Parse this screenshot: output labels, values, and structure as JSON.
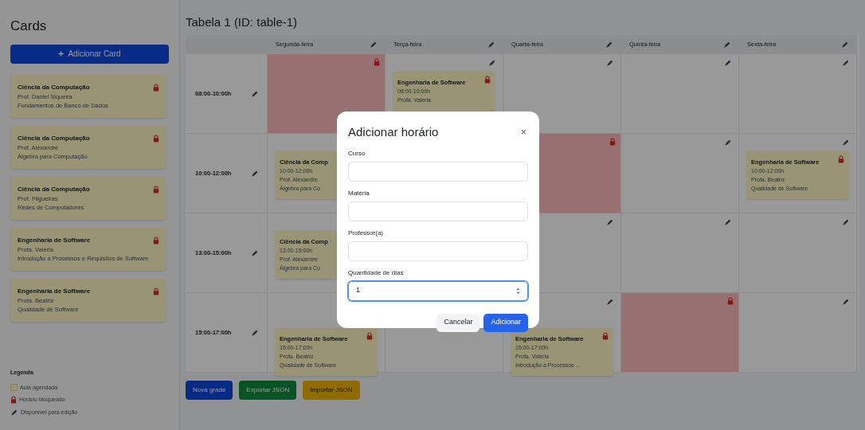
{
  "sidebar": {
    "title": "Cards",
    "add_button": "Adicionar Card",
    "cards": [
      {
        "course": "Ciência da Computação",
        "professor": "Prof. Daniel Siqueira",
        "subject": "Fundamentos de Banco de Dados"
      },
      {
        "course": "Ciência da Computação",
        "professor": "Prof. Alexandre",
        "subject": "Álgebra para Computação"
      },
      {
        "course": "Ciência da Computação",
        "professor": "Prof. Filgueiras",
        "subject": "Redes de Computadores"
      },
      {
        "course": "Engenharia de Software",
        "professor": "Profa. Valeria",
        "subject": "Introdução a Processos e Requisitos de Software"
      },
      {
        "course": "Engenharia de Software",
        "professor": "Profa. Beatriz",
        "subject": "Qualidade de Software"
      }
    ],
    "legend": {
      "title": "Legenda",
      "items": [
        {
          "kind": "scheduled",
          "label": "Aula agendada"
        },
        {
          "kind": "blocked",
          "label": "Horário bloqueado"
        },
        {
          "kind": "editable",
          "label": "Disponível para edição"
        }
      ]
    }
  },
  "table": {
    "title": "Tabela 1 (ID: table-1)",
    "columns": [
      "Segunda-feira",
      "Terça-feira",
      "Quarta-feira",
      "Quinta-feira",
      "Sexta-feira"
    ],
    "rows": [
      {
        "time": "08:00-10:00h",
        "cells": [
          {
            "kind": "blocked"
          },
          {
            "kind": "class",
            "lines": [
              "Engenharia de Software",
              "08:00-10:00h",
              "Profa. Valeria"
            ]
          },
          {
            "kind": "empty"
          },
          {
            "kind": "empty"
          },
          {
            "kind": "empty"
          }
        ]
      },
      {
        "time": "10:00-12:00h",
        "cells": [
          {
            "kind": "class",
            "partly_covered": true,
            "lines": [
              "Ciência da Comp",
              "10:00-12:00h",
              "Prof. Alexandre",
              "Álgebra para Co"
            ]
          },
          {
            "kind": "covered"
          },
          {
            "kind": "blocked"
          },
          {
            "kind": "empty"
          },
          {
            "kind": "class",
            "lines": [
              "Engenharia de Software",
              "10:00-12:00h",
              "Profa. Beatriz",
              "Qualidade de Software"
            ]
          }
        ]
      },
      {
        "time": "13:00-15:00h",
        "cells": [
          {
            "kind": "class",
            "partly_covered": true,
            "lines": [
              "Ciência da Comp",
              "13:00-15:00h",
              "Prof. Alexandre",
              "Álgebra para Co"
            ]
          },
          {
            "kind": "covered"
          },
          {
            "kind": "empty"
          },
          {
            "kind": "empty"
          },
          {
            "kind": "empty"
          }
        ]
      },
      {
        "time": "15:00-17:00h",
        "cells": [
          {
            "kind": "class",
            "lines": [
              "Engenharia de Software",
              "15:00-17:00h",
              "Profa. Beatriz",
              "Qualidade de Software"
            ]
          },
          {
            "kind": "covered"
          },
          {
            "kind": "class",
            "lines": [
              "Engenharia de Software",
              "15:00-17:00h",
              "Profa. Valeria",
              "Introdução a Processos ..."
            ]
          },
          {
            "kind": "blocked"
          },
          {
            "kind": "empty"
          }
        ]
      }
    ]
  },
  "actions": [
    {
      "label": "Nova grade",
      "kind": "new"
    },
    {
      "label": "Exportar JSON",
      "kind": "export"
    },
    {
      "label": "Importar JSON",
      "kind": "import"
    }
  ],
  "modal": {
    "title": "Adicionar horário",
    "close": "×",
    "fields": [
      {
        "label": "Curso",
        "kind": "text",
        "focused": false
      },
      {
        "label": "Matéria",
        "kind": "text",
        "focused": false
      },
      {
        "label": "Professor(a)",
        "kind": "text",
        "focused": false
      },
      {
        "label": "Quantidade de dias",
        "kind": "number",
        "value": "1",
        "focused": true
      }
    ],
    "buttons": [
      {
        "label": "Cancelar",
        "kind": "secondary"
      },
      {
        "label": "Adicionar",
        "kind": "primary"
      }
    ]
  }
}
